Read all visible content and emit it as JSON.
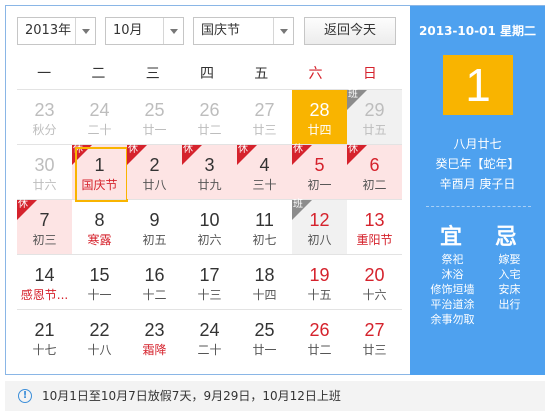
{
  "controls": {
    "year": "2013年",
    "month": "10月",
    "holiday": "国庆节",
    "today_button": "返回今天"
  },
  "weekdays": [
    "一",
    "二",
    "三",
    "四",
    "五",
    "六",
    "日"
  ],
  "weeks": [
    [
      {
        "day": "23",
        "sub": "秋分",
        "other": true
      },
      {
        "day": "24",
        "sub": "二十",
        "other": true
      },
      {
        "day": "25",
        "sub": "廿一",
        "other": true
      },
      {
        "day": "26",
        "sub": "廿二",
        "other": true
      },
      {
        "day": "27",
        "sub": "廿三",
        "other": true
      },
      {
        "day": "28",
        "sub": "廿四",
        "other": true,
        "today": true
      },
      {
        "day": "29",
        "sub": "廿五",
        "other": true,
        "badge": "班"
      }
    ],
    [
      {
        "day": "30",
        "sub": "廿六",
        "other": true
      },
      {
        "day": "1",
        "sub": "国庆节",
        "badge": "休",
        "selected": true,
        "fest": true
      },
      {
        "day": "2",
        "sub": "廿八",
        "badge": "休"
      },
      {
        "day": "3",
        "sub": "廿九",
        "badge": "休"
      },
      {
        "day": "4",
        "sub": "三十",
        "badge": "休"
      },
      {
        "day": "5",
        "sub": "初一",
        "badge": "休",
        "weekend": true
      },
      {
        "day": "6",
        "sub": "初二",
        "badge": "休",
        "weekend": true
      }
    ],
    [
      {
        "day": "7",
        "sub": "初三",
        "badge": "休"
      },
      {
        "day": "8",
        "sub": "寒露",
        "fest": true
      },
      {
        "day": "9",
        "sub": "初五"
      },
      {
        "day": "10",
        "sub": "初六"
      },
      {
        "day": "11",
        "sub": "初七"
      },
      {
        "day": "12",
        "sub": "初八",
        "badge": "班",
        "weekend": true
      },
      {
        "day": "13",
        "sub": "重阳节",
        "weekend": true,
        "fest": true
      }
    ],
    [
      {
        "day": "14",
        "sub": "感恩节...",
        "fest": true
      },
      {
        "day": "15",
        "sub": "十一"
      },
      {
        "day": "16",
        "sub": "十二"
      },
      {
        "day": "17",
        "sub": "十三"
      },
      {
        "day": "18",
        "sub": "十四"
      },
      {
        "day": "19",
        "sub": "十五",
        "weekend": true
      },
      {
        "day": "20",
        "sub": "十六",
        "weekend": true
      }
    ],
    [
      {
        "day": "21",
        "sub": "十七"
      },
      {
        "day": "22",
        "sub": "十八"
      },
      {
        "day": "23",
        "sub": "霜降",
        "fest": true
      },
      {
        "day": "24",
        "sub": "二十"
      },
      {
        "day": "25",
        "sub": "廿一"
      },
      {
        "day": "26",
        "sub": "廿二",
        "weekend": true
      },
      {
        "day": "27",
        "sub": "廿三",
        "weekend": true
      }
    ]
  ],
  "side": {
    "date": "2013-10-01 星期二",
    "big_day": "1",
    "lunar_day": "八月廿七",
    "lunar_year": "癸巳年【蛇年】",
    "lunar_month": "辛酉月 庚子日",
    "yi_title": "宜",
    "ji_title": "忌",
    "yi": [
      "祭祀",
      "沐浴",
      "修饰垣墙",
      "平治道涂",
      "余事勿取"
    ],
    "ji": [
      "嫁娶",
      "入宅",
      "安床",
      "出行"
    ]
  },
  "footer": {
    "icon": "info-icon",
    "text": "10月1日至10月7日放假7天，9月29日，10月12日上班"
  },
  "colors": {
    "accent": "#4ea1ef",
    "today": "#f9b400",
    "holiday_red": "#d5222c",
    "rest_bg": "#fde4e4"
  }
}
